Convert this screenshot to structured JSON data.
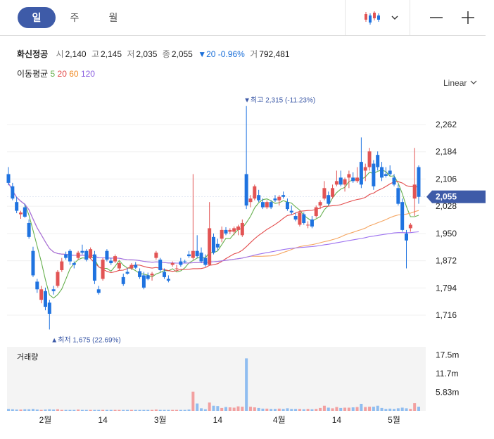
{
  "period_tabs": [
    {
      "label": "일",
      "active": true
    },
    {
      "label": "주",
      "active": false
    },
    {
      "label": "월",
      "active": false
    }
  ],
  "toolbar": {
    "chart_type_icon": "candlestick-icon",
    "dropdown_icon": "chevron-down-icon",
    "minus_icon": "zoom-out-minus-icon",
    "plus_icon": "zoom-in-plus-icon"
  },
  "stock": {
    "name": "화신정공",
    "open_label": "시",
    "open": "2,140",
    "high_label": "고",
    "high": "2,145",
    "low_label": "저",
    "low": "2,035",
    "close_label": "종",
    "close": "2,055",
    "change": "▼20 -0.96%",
    "volume_label": "거",
    "volume": "792,481"
  },
  "ma_legend": {
    "label": "이동평균",
    "periods": [
      {
        "text": "5",
        "color": "#67b04f"
      },
      {
        "text": "20",
        "color": "#e34a4a"
      },
      {
        "text": "60",
        "color": "#f08a24"
      },
      {
        "text": "120",
        "color": "#8a5fe0"
      }
    ]
  },
  "scale_mode": "Linear",
  "colors": {
    "up": "#e25454",
    "down": "#1f73e0",
    "ma5": "#67b04f",
    "ma20": "#e34a4a",
    "ma60": "#f5a560",
    "ma120": "#9d72f0",
    "current_price_badge": "#3e5ba8"
  },
  "chart_data": {
    "type": "candlestick",
    "price_axis": {
      "ticks": [
        "2,262",
        "2,184",
        "2,106",
        "2,028",
        "1,950",
        "1,872",
        "1,794",
        "1,716"
      ],
      "current": "2,055",
      "range": [
        1640,
        2360
      ]
    },
    "time_axis": {
      "labels": [
        "2월",
        "14",
        "3월",
        "14",
        "4월",
        "14",
        "5월"
      ]
    },
    "annotations": {
      "high": "▼최고 2,315 (-11.23%)",
      "low": "▲최저 1,675 (22.69%)"
    },
    "volume_panel": {
      "label": "거래량",
      "ticks": [
        "17.5m",
        "11.7m",
        "5.83m"
      ],
      "max": 20
    },
    "candles": [
      [
        2120,
        2140,
        2088,
        2095
      ],
      [
        2085,
        2095,
        2045,
        2050
      ],
      [
        2040,
        2055,
        2008,
        2015
      ],
      [
        2005,
        2015,
        1992,
        2010
      ],
      [
        2025,
        2035,
        1995,
        1998
      ],
      [
        1980,
        1990,
        1935,
        1940
      ],
      [
        1900,
        1912,
        1825,
        1830
      ],
      [
        1812,
        1820,
        1780,
        1790
      ],
      [
        1760,
        1800,
        1750,
        1790
      ],
      [
        1785,
        1795,
        1730,
        1740
      ],
      [
        1752,
        1760,
        1675,
        1720
      ],
      [
        1790,
        1800,
        1775,
        1785
      ],
      [
        1800,
        1845,
        1795,
        1840
      ],
      [
        1845,
        1880,
        1840,
        1870
      ],
      [
        1890,
        1898,
        1875,
        1880
      ],
      [
        1900,
        1905,
        1860,
        1870
      ],
      [
        1865,
        1870,
        1850,
        1860
      ],
      [
        1880,
        1900,
        1875,
        1895
      ],
      [
        1900,
        1918,
        1890,
        1895
      ],
      [
        1900,
        1905,
        1870,
        1875
      ],
      [
        1880,
        1910,
        1878,
        1905
      ],
      [
        1890,
        1900,
        1805,
        1815
      ],
      [
        1790,
        1800,
        1775,
        1780
      ],
      [
        1820,
        1880,
        1815,
        1875
      ],
      [
        1900,
        1905,
        1870,
        1875
      ],
      [
        1872,
        1880,
        1860,
        1865
      ],
      [
        1870,
        1890,
        1865,
        1885
      ],
      [
        1850,
        1870,
        1845,
        1865
      ],
      [
        1825,
        1835,
        1800,
        1805
      ],
      [
        1840,
        1850,
        1832,
        1835
      ],
      [
        1850,
        1865,
        1845,
        1860
      ],
      [
        1860,
        1868,
        1848,
        1852
      ],
      [
        1842,
        1850,
        1820,
        1825
      ],
      [
        1830,
        1840,
        1790,
        1795
      ],
      [
        1830,
        1838,
        1816,
        1820
      ],
      [
        1830,
        1840,
        1815,
        1835
      ],
      [
        1880,
        1900,
        1875,
        1895
      ],
      [
        1875,
        1880,
        1840,
        1845
      ],
      [
        1840,
        1850,
        1820,
        1825
      ],
      [
        1820,
        1830,
        1810,
        1815
      ],
      [
        1860,
        1870,
        1855,
        1865
      ],
      [
        1850,
        1860,
        1845,
        1850
      ],
      [
        1870,
        1880,
        1855,
        1860
      ],
      [
        1870,
        1875,
        1865,
        1868
      ],
      [
        1890,
        1900,
        1880,
        1885
      ],
      [
        1880,
        2120,
        1875,
        1900
      ],
      [
        1900,
        1945,
        1880,
        1885
      ],
      [
        1895,
        1910,
        1865,
        1870
      ],
      [
        1880,
        1890,
        1855,
        1860
      ],
      [
        1860,
        2040,
        1860,
        1965
      ],
      [
        1940,
        1950,
        1890,
        1895
      ],
      [
        1920,
        1935,
        1900,
        1910
      ],
      [
        1935,
        1970,
        1925,
        1960
      ],
      [
        1960,
        1968,
        1945,
        1950
      ],
      [
        1955,
        1965,
        1948,
        1960
      ],
      [
        1955,
        1970,
        1945,
        1965
      ],
      [
        1960,
        1975,
        1945,
        1970
      ],
      [
        1945,
        1990,
        1940,
        1980
      ],
      [
        2120,
        2315,
        2020,
        2030
      ],
      [
        2040,
        2060,
        2025,
        2050
      ],
      [
        2050,
        2090,
        2045,
        2085
      ],
      [
        2060,
        2075,
        2040,
        2045
      ],
      [
        2040,
        2050,
        2020,
        2025
      ],
      [
        2025,
        2045,
        2020,
        2040
      ],
      [
        2040,
        2045,
        2020,
        2025
      ],
      [
        2050,
        2060,
        2040,
        2045
      ],
      [
        2045,
        2060,
        2030,
        2055
      ],
      [
        2060,
        2070,
        2050,
        2055
      ],
      [
        2040,
        2050,
        2015,
        2020
      ],
      [
        2015,
        2030,
        2005,
        2010
      ],
      [
        2000,
        2010,
        1985,
        1990
      ],
      [
        1975,
        2015,
        1970,
        2010
      ],
      [
        2005,
        2010,
        1975,
        1980
      ],
      [
        1975,
        1985,
        1965,
        1975
      ],
      [
        1990,
        2000,
        1965,
        1970
      ],
      [
        2000,
        2030,
        1995,
        2025
      ],
      [
        2030,
        2045,
        2020,
        2040
      ],
      [
        2050,
        2100,
        2045,
        2080
      ],
      [
        2060,
        2070,
        2030,
        2035
      ],
      [
        2055,
        2090,
        2050,
        2080
      ],
      [
        2090,
        2130,
        2085,
        2100
      ],
      [
        2110,
        2130,
        2085,
        2090
      ],
      [
        2090,
        2110,
        2070,
        2105
      ],
      [
        2110,
        2130,
        2080,
        2120
      ],
      [
        2110,
        2125,
        2095,
        2100
      ],
      [
        2100,
        2140,
        2095,
        2110
      ],
      [
        2155,
        2225,
        2080,
        2090
      ],
      [
        2130,
        2150,
        2100,
        2140
      ],
      [
        2140,
        2195,
        2130,
        2185
      ],
      [
        2150,
        2160,
        2075,
        2085
      ],
      [
        2175,
        2185,
        2130,
        2140
      ],
      [
        2140,
        2155,
        2100,
        2110
      ],
      [
        2120,
        2140,
        2110,
        2115
      ],
      [
        2130,
        2145,
        2115,
        2120
      ],
      [
        2110,
        2120,
        2085,
        2090
      ],
      [
        2080,
        2090,
        2030,
        2035
      ],
      [
        2040,
        2050,
        1955,
        1960
      ],
      [
        1950,
        1960,
        1850,
        1930
      ],
      [
        1965,
        1980,
        1955,
        1975
      ],
      [
        2050,
        2195,
        2000,
        2090
      ],
      [
        2140,
        2145,
        2035,
        2055
      ]
    ],
    "volumes": [
      0.6,
      0.5,
      0.4,
      0.4,
      0.5,
      0.5,
      0.6,
      0.4,
      0.3,
      0.4,
      0.5,
      0.4,
      0.5,
      0.3,
      0.3,
      0.3,
      0.3,
      0.4,
      0.3,
      0.3,
      0.3,
      0.3,
      0.3,
      0.3,
      0.3,
      0.3,
      0.3,
      0.3,
      0.3,
      0.3,
      0.3,
      0.3,
      0.3,
      0.3,
      0.3,
      0.3,
      0.4,
      0.3,
      0.3,
      0.3,
      0.3,
      0.3,
      0.3,
      0.3,
      0.4,
      6.0,
      2.3,
      0.8,
      0.5,
      2.6,
      1.6,
      1.5,
      0.9,
      1.2,
      1.1,
      1.0,
      1.4,
      1.3,
      16.4,
      1.3,
      1.1,
      0.9,
      0.7,
      0.7,
      0.6,
      0.6,
      0.7,
      0.6,
      0.8,
      0.6,
      0.6,
      0.6,
      0.5,
      0.6,
      0.5,
      0.6,
      0.9,
      1.6,
      1.0,
      0.8,
      1.2,
      0.9,
      1.0,
      1.0,
      1.1,
      1.2,
      2.2,
      1.2,
      1.3,
      1.3,
      1.6,
      0.9,
      0.6,
      0.7,
      0.6,
      0.8,
      1.0,
      0.8,
      0.6,
      2.4,
      1.3
    ]
  }
}
